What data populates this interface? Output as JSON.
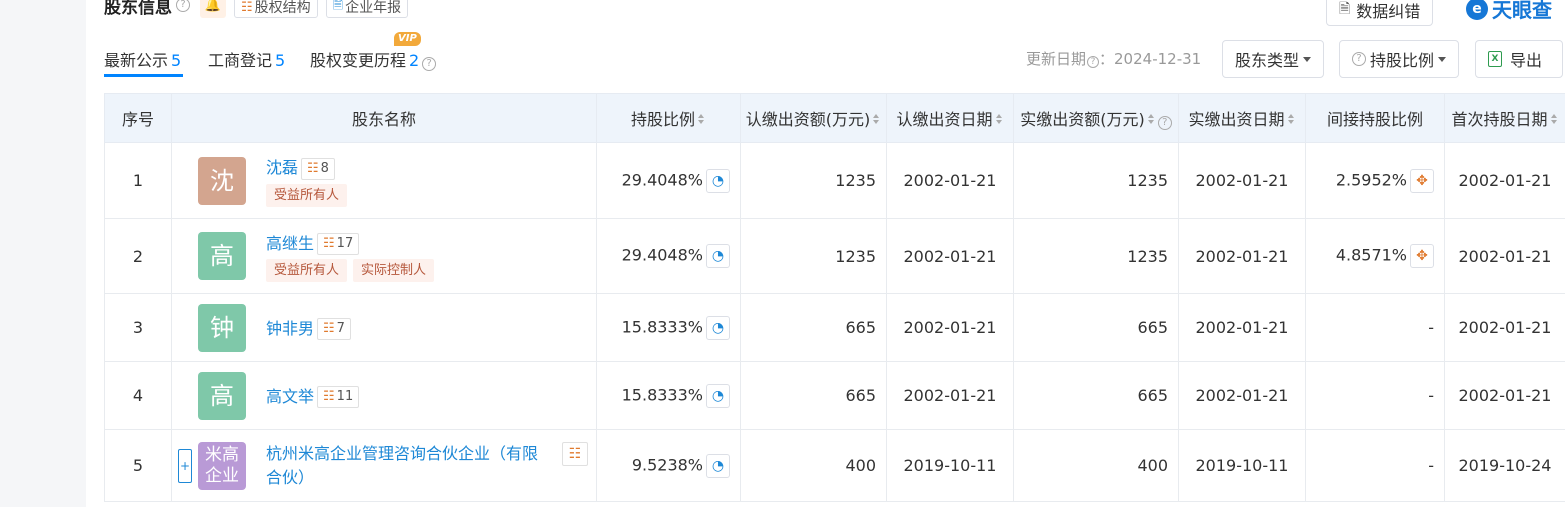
{
  "header": {
    "title": "股东信息",
    "btn_equity": "股权结构",
    "btn_annual": "企业年报",
    "btn_correction": "数据纠错",
    "logo_text": "天眼查"
  },
  "tabs": [
    {
      "label": "最新公示",
      "count": "5"
    },
    {
      "label": "工商登记",
      "count": "5"
    },
    {
      "label": "股权变更历程",
      "count": "2"
    }
  ],
  "vip_badge": "VIP",
  "update_label": "更新日期",
  "update_date": "：2024-12-31",
  "controls": {
    "shareholder_type": "股东类型",
    "holding_ratio": "持股比例",
    "export": "导出"
  },
  "columns": [
    "序号",
    "股东名称",
    "持股比例",
    "认缴出资额(万元)",
    "认缴出资日期",
    "实缴出资额(万元)",
    "实缴出资日期",
    "间接持股比例",
    "首次持股日期"
  ],
  "rows": [
    {
      "no": "1",
      "avatar": "沈",
      "avatar_color": "#d3a58f",
      "name": "沈磊",
      "rel": "8",
      "tags": [
        "受益所有人"
      ],
      "ratio": "29.4048%",
      "sub_amt": "1235",
      "sub_date": "2002-01-21",
      "paid_amt": "1235",
      "paid_date": "2002-01-21",
      "indirect": "2.5952%",
      "first_date": "2002-01-21"
    },
    {
      "no": "2",
      "avatar": "高",
      "avatar_color": "#7fc8a9",
      "name": "高继生",
      "rel": "17",
      "tags": [
        "受益所有人",
        "实际控制人"
      ],
      "ratio": "29.4048%",
      "sub_amt": "1235",
      "sub_date": "2002-01-21",
      "paid_amt": "1235",
      "paid_date": "2002-01-21",
      "indirect": "4.8571%",
      "first_date": "2002-01-21"
    },
    {
      "no": "3",
      "avatar": "钟",
      "avatar_color": "#7fc8a9",
      "name": "钟非男",
      "rel": "7",
      "tags": [],
      "ratio": "15.8333%",
      "sub_amt": "665",
      "sub_date": "2002-01-21",
      "paid_amt": "665",
      "paid_date": "2002-01-21",
      "indirect": "-",
      "first_date": "2002-01-21"
    },
    {
      "no": "4",
      "avatar": "高",
      "avatar_color": "#7fc8a9",
      "name": "高文举",
      "rel": "11",
      "tags": [],
      "ratio": "15.8333%",
      "sub_amt": "665",
      "sub_date": "2002-01-21",
      "paid_amt": "665",
      "paid_date": "2002-01-21",
      "indirect": "-",
      "first_date": "2002-01-21"
    },
    {
      "no": "5",
      "avatar": "米高企业",
      "avatar_color": "#b99ad6",
      "name": "杭州米高企业管理咨询合伙企业（有限合伙）",
      "name_line1": "杭州米高企业管理咨询合伙企业（有限",
      "name_line2": "合伙）",
      "ratio": "9.5238%",
      "sub_amt": "400",
      "sub_date": "2019-10-11",
      "paid_amt": "400",
      "paid_date": "2019-10-11",
      "indirect": "-",
      "first_date": "2019-10-24"
    }
  ]
}
